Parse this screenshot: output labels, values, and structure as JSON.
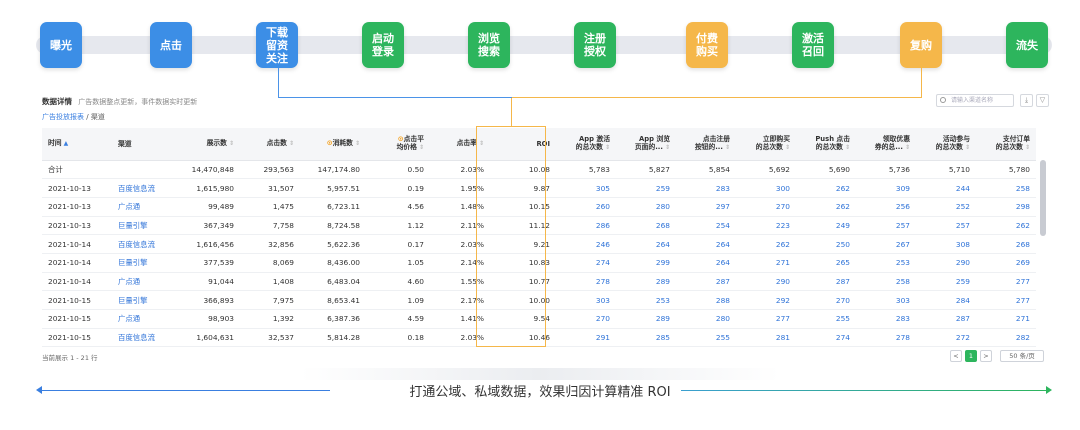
{
  "funnel": [
    {
      "label": "曝光",
      "color": "#3c8ee6"
    },
    {
      "label": "点击",
      "color": "#3c8ee6"
    },
    {
      "label": "下载\n留资\n关注",
      "color": "#3c8ee6"
    },
    {
      "label": "启动\n登录",
      "color": "#2db55d"
    },
    {
      "label": "浏览\n搜索",
      "color": "#2db55d"
    },
    {
      "label": "注册\n授权",
      "color": "#2db55d"
    },
    {
      "label": "付费\n购买",
      "color": "#f5b74a"
    },
    {
      "label": "激活\n召回",
      "color": "#2db55d"
    },
    {
      "label": "复购",
      "color": "#f5b74a"
    },
    {
      "label": "流失",
      "color": "#2db55d"
    }
  ],
  "header": {
    "title": "数据详情",
    "subtitle": "广告数据整点更新，事件数据实时更新",
    "search_placeholder": "请输入渠道名称",
    "breadcrumb_root": "广告投放报表",
    "breadcrumb_sep": "/",
    "breadcrumb_current": "渠道"
  },
  "columns": [
    "时间",
    "渠道",
    "展示数",
    "点击数",
    "消耗数",
    "点击平均价格",
    "点击率",
    "ROI",
    "App 激活的总次数",
    "App 浏览页面的...",
    "点击注册按钮的...",
    "立即购买的总次数",
    "Push 点击的总次数",
    "领取优惠券的总...",
    "活动参与的总次数",
    "支付订单的总次数"
  ],
  "header_cells": [
    {
      "l1": "时间",
      "l2": ""
    },
    {
      "l1": "渠道",
      "l2": ""
    },
    {
      "l1": "展示数",
      "l2": ""
    },
    {
      "l1": "点击数",
      "l2": ""
    },
    {
      "l1": "消耗数",
      "l2": ""
    },
    {
      "l1": "点击平",
      "l2": "均价格"
    },
    {
      "l1": "点击率",
      "l2": ""
    },
    {
      "l1": "ROI",
      "l2": ""
    },
    {
      "l1": "App 激活",
      "l2": "的总次数"
    },
    {
      "l1": "App 浏览",
      "l2": "页面的..."
    },
    {
      "l1": "点击注册",
      "l2": "按钮的..."
    },
    {
      "l1": "立即购买",
      "l2": "的总次数"
    },
    {
      "l1": "Push 点击",
      "l2": "的总次数"
    },
    {
      "l1": "领取优惠",
      "l2": "券的总..."
    },
    {
      "l1": "活动参与",
      "l2": "的总次数"
    },
    {
      "l1": "支付订单",
      "l2": "的总次数"
    }
  ],
  "total_row": [
    "合计",
    "",
    "14,470,848",
    "293,563",
    "147,174.80",
    "0.50",
    "2.03%",
    "10.08",
    "5,783",
    "5,827",
    "5,854",
    "5,692",
    "5,690",
    "5,736",
    "5,710",
    "5,780"
  ],
  "rows": [
    [
      "2021-10-13",
      "百度信息流",
      "1,615,980",
      "31,507",
      "5,957.51",
      "0.19",
      "1.95%",
      "9.87",
      "305",
      "259",
      "283",
      "300",
      "262",
      "309",
      "244",
      "258"
    ],
    [
      "2021-10-13",
      "广点通",
      "99,489",
      "1,475",
      "6,723.11",
      "4.56",
      "1.48%",
      "10.15",
      "260",
      "280",
      "297",
      "270",
      "262",
      "256",
      "252",
      "298"
    ],
    [
      "2021-10-13",
      "巨量引擎",
      "367,349",
      "7,758",
      "8,724.58",
      "1.12",
      "2.11%",
      "11.12",
      "286",
      "268",
      "254",
      "223",
      "249",
      "257",
      "257",
      "262"
    ],
    [
      "2021-10-14",
      "百度信息流",
      "1,616,456",
      "32,856",
      "5,622.36",
      "0.17",
      "2.03%",
      "9.21",
      "246",
      "264",
      "264",
      "262",
      "250",
      "267",
      "308",
      "268"
    ],
    [
      "2021-10-14",
      "巨量引擎",
      "377,539",
      "8,069",
      "8,436.00",
      "1.05",
      "2.14%",
      "10.83",
      "274",
      "299",
      "264",
      "271",
      "265",
      "253",
      "290",
      "269"
    ],
    [
      "2021-10-14",
      "广点通",
      "91,044",
      "1,408",
      "6,483.04",
      "4.60",
      "1.55%",
      "10.77",
      "278",
      "289",
      "287",
      "290",
      "287",
      "258",
      "259",
      "277"
    ],
    [
      "2021-10-15",
      "巨量引擎",
      "366,893",
      "7,975",
      "8,653.41",
      "1.09",
      "2.17%",
      "10.00",
      "303",
      "253",
      "288",
      "292",
      "270",
      "303",
      "284",
      "277"
    ],
    [
      "2021-10-15",
      "广点通",
      "98,903",
      "1,392",
      "6,387.36",
      "4.59",
      "1.41%",
      "9.54",
      "270",
      "289",
      "280",
      "277",
      "255",
      "283",
      "287",
      "271"
    ],
    [
      "2021-10-15",
      "百度信息流",
      "1,604,631",
      "32,537",
      "5,814.28",
      "0.18",
      "2.03%",
      "10.46",
      "291",
      "285",
      "255",
      "281",
      "274",
      "278",
      "272",
      "282"
    ]
  ],
  "footer": {
    "range_text": "当前展示 1 - 21 行",
    "page_prev": "<",
    "page_current": "1",
    "page_next": ">",
    "page_size": "50 条/页"
  },
  "tagline": "打通公域、私域数据，效果归因计算精准 ROI",
  "colors": {
    "blue": "#3c8ee6",
    "green": "#2db55d",
    "orange": "#f5b74a",
    "link": "#2f73d8"
  }
}
